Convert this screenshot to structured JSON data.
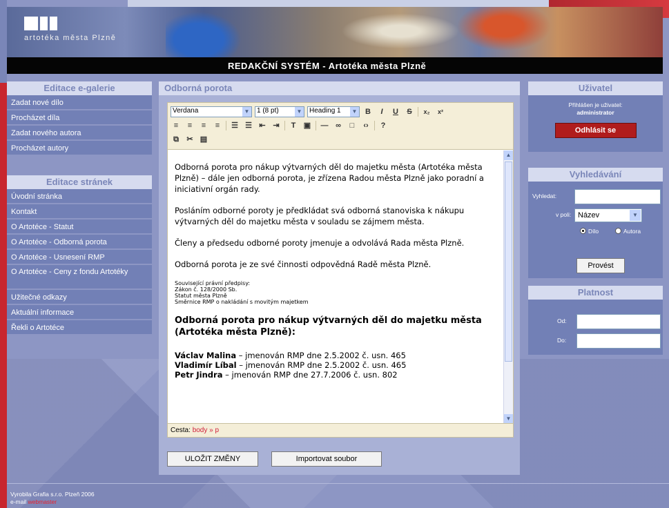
{
  "header": {
    "logo_text": "artotéka města Plzně",
    "title": "REDAKČNÍ SYSTÉM - Artotéka města Plzně"
  },
  "gallery": {
    "heading": "Editace e-galerie",
    "items": [
      "Zadat nové dílo",
      "Procházet díla",
      "Zadat nového autora",
      "Procházet autory"
    ]
  },
  "pages": {
    "heading": "Editace stránek",
    "items": [
      "Úvodní stránka",
      "Kontakt",
      "O Artotéce - Statut",
      "O Artotéce - Odborná porota",
      "O Artotéce - Usnesení RMP",
      "O Artotéce - Ceny z fondu Artotéky",
      "Užitečné odkazy",
      "Aktuální informace",
      "Řekli o Artotéce"
    ]
  },
  "editor": {
    "heading": "Odborná porota",
    "font_family": "Verdana",
    "font_size": "1 (8 pt)",
    "format": "Heading 1",
    "paragraphs": [
      "Odborná porota pro nákup výtvarných děl do majetku města (Artotéka města Plzně) – dále jen odborná porota, je zřízena Radou města Plzně jako poradní a iniciativní orgán rady.",
      "Posláním odborné poroty je předkládat svá odborná stanoviska k nákupu výtvarných děl do majetku města v souladu se zájmem města.",
      "Členy a předsedu odborné poroty jmenuje a odvolává Rada města Plzně.",
      "Odborná porota je ze své činnosti odpovědná Radě města Plzně."
    ],
    "legal_heading": "Související právní předpisy:",
    "legal_lines": [
      "Zákon č. 128/2000 Sb.",
      "Statut města Plzně",
      "Směrnice RMP o nakládání s movitým majetkem"
    ],
    "bold_heading": "Odborná porota pro nákup výtvarných děl do majetku města (Artotéka města Plzně):",
    "members": [
      {
        "name": "Václav Malina",
        "text": " – jmenován RMP dne 2.5.2002 č. usn. 465"
      },
      {
        "name": "Vladimír Líbal",
        "text": " – jmenován RMP dne 2.5.2002 č. usn. 465"
      },
      {
        "name": "Petr Jindra",
        "text": " – jmenován RMP dne 27.7.2006 č. usn. 802"
      }
    ],
    "path_label": "Cesta:",
    "path": "body » p",
    "save_label": "ULOŽIT ZMĚNY",
    "import_label": "Importovat soubor"
  },
  "user": {
    "heading": "Uživatel",
    "logged_label": "Přihlášen je uživatel:",
    "username": "administrator",
    "logout_label": "Odhlásit se"
  },
  "search": {
    "heading": "Vyhledávání",
    "query_label": "Vyhledat:",
    "field_label": "v poli:",
    "field_value": "Název",
    "radio_dilo": "Dílo",
    "radio_autora": "Autora",
    "submit_label": "Provést"
  },
  "validity": {
    "heading": "Platnost",
    "from_label": "Od:",
    "to_label": "Do:"
  },
  "footer": {
    "credit": "Vyrobila Grafia s.r.o. Plzeň 2006",
    "email_label": "e-mail",
    "email_link": "webmaster"
  }
}
